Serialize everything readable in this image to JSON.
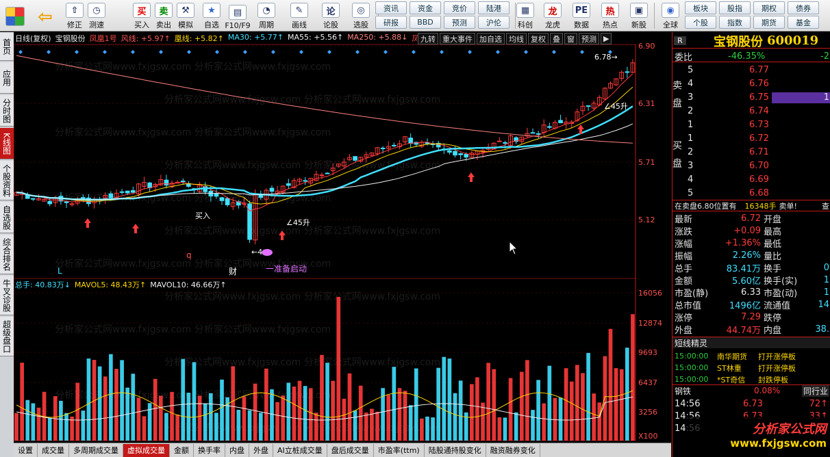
{
  "toolbar": {
    "nav": [
      {
        "label": "修正",
        "icon": "up-arrow-icon"
      },
      {
        "label": "测速",
        "icon": "clock-icon"
      },
      {
        "label": "买入",
        "icon": "buy-icon"
      },
      {
        "label": "卖出",
        "icon": "sell-icon"
      },
      {
        "label": "模拟",
        "icon": "hammer-icon"
      },
      {
        "label": "自选",
        "icon": "star-icon"
      },
      {
        "label": "F10/F9",
        "icon": "f10-icon"
      },
      {
        "label": "周期",
        "icon": "period-icon"
      },
      {
        "label": "画线",
        "icon": "pen-icon"
      },
      {
        "label": "论股",
        "icon": "talk-icon"
      },
      {
        "label": "选股",
        "icon": "select-stock-icon"
      },
      {
        "label": "科创",
        "icon": "kechuang-icon"
      },
      {
        "label": "龙虎",
        "icon": "dragon-tiger-icon"
      },
      {
        "label": "数据",
        "icon": "pe-icon"
      },
      {
        "label": "热点",
        "icon": "hot-icon"
      },
      {
        "label": "新股",
        "icon": "new-stock-icon"
      },
      {
        "label": "全球",
        "icon": "globe-icon"
      }
    ],
    "grid1": [
      "资讯",
      "资金",
      "竞价",
      "陆港",
      "研报",
      "BBD",
      "预测",
      "沪伦"
    ],
    "grid2": [
      "板块",
      "股指",
      "期权",
      "债券",
      "个股",
      "指数",
      "期货",
      "基金"
    ]
  },
  "sidetabs": [
    "首页",
    "应用",
    "分时图",
    "K线图",
    "个股资料",
    "自选股",
    "综合排名",
    "牛叉诊股",
    "超级盘口"
  ],
  "chart": {
    "legend": {
      "period": "日线(复权)",
      "name": "宝钢股份",
      "fh": "凤凰1号",
      "fengxian": "风线: +5.97↑",
      "huangxian": "凰线: +5.82↑",
      "ma30": "MA30: +5.77↑",
      "ma55": "MA55: +5.56↑",
      "ma250": "MA250: +5.88↓",
      "fengmo": "凤末"
    },
    "topbtns": [
      "九转",
      "重大事件",
      "加自选",
      "均线",
      "复权",
      "叠",
      "窗",
      "预测",
      "▶"
    ],
    "yaxis": [
      "6.90",
      "6.31",
      "5.71",
      "5.12"
    ],
    "volaxis": [
      "16056",
      "12874",
      "9693",
      "6437",
      "3256",
      "X100"
    ],
    "annotations": {
      "high": "6.78",
      "up45a": "45升",
      "up45b": "45升",
      "buy": "买入",
      "low": "4.6",
      "L": "L",
      "q": "q",
      "cai": "财",
      "start": "一准备启动"
    },
    "vol_legend": {
      "total": "总手: 40.83万↓",
      "mavol5": "MAVOL5: 48.43万↑",
      "mavol10": "MAVOL10: 46.66万↑"
    },
    "watermark": "分析家公式网www.fxjgsw.com"
  },
  "bottomtabs": [
    "设置",
    "成交量",
    "多周期成交量",
    "虚拟成交量",
    "金额",
    "换手率",
    "内盘",
    "外盘",
    "AI立桩成交量",
    "盘后成交量",
    "市盈率(ttm)",
    "陆股通持股变化",
    "融资融券变化"
  ],
  "quote": {
    "flag": "R",
    "name": "宝钢股份",
    "code": "600019",
    "weibi_label": "委比",
    "weibi": "-46.35%",
    "weibi_extra": "-2",
    "sell_label": "卖盘",
    "buy_label": "买盘",
    "asks": [
      {
        "lvl": "5",
        "price": "6.77"
      },
      {
        "lvl": "4",
        "price": "6.76"
      },
      {
        "lvl": "3",
        "price": "6.75",
        "vol": "1"
      },
      {
        "lvl": "2",
        "price": "6.74"
      },
      {
        "lvl": "1",
        "price": "6.73"
      }
    ],
    "bids": [
      {
        "lvl": "1",
        "price": "6.72"
      },
      {
        "lvl": "2",
        "price": "6.71"
      },
      {
        "lvl": "3",
        "price": "6.70"
      },
      {
        "lvl": "4",
        "price": "6.69"
      },
      {
        "lvl": "5",
        "price": "6.68"
      }
    ],
    "notice": "在卖盘6.80位置有",
    "notice_vol": "16348手",
    "notice_tail": "卖单!",
    "notice_btn": "查",
    "stats": [
      {
        "l": "最新",
        "v": "6.72",
        "c": "red",
        "l2": "开盘",
        "v2": ""
      },
      {
        "l": "涨跌",
        "v": "+0.09",
        "c": "red",
        "l2": "最高",
        "v2": ""
      },
      {
        "l": "涨幅",
        "v": "+1.36%",
        "c": "red",
        "l2": "最低",
        "v2": ""
      },
      {
        "l": "振幅",
        "v": "2.26%",
        "c": "cyan",
        "l2": "量比",
        "v2": ""
      },
      {
        "l": "总手",
        "v": "83.41万",
        "c": "cyan",
        "l2": "换手",
        "v2": "0"
      },
      {
        "l": "金额",
        "v": "5.60亿",
        "c": "cyan",
        "l2": "换手(实)",
        "v2": "1"
      },
      {
        "l": "市盈(静)",
        "v": "6.33",
        "c": "white",
        "l2": "市盈(动)",
        "v2": "1"
      },
      {
        "l": "总市值",
        "v": "1496亿",
        "c": "cyan",
        "l2": "流通值",
        "v2": "14"
      },
      {
        "l": "涨停",
        "v": "7.29",
        "c": "red",
        "l2": "跌停",
        "v2": ""
      },
      {
        "l": "外盘",
        "v": "44.74万",
        "c": "red",
        "l2": "内盘",
        "v2": "38."
      }
    ],
    "elf_title": "短线精灵",
    "elf": [
      {
        "t": "15:00:00",
        "n": "南华期货",
        "e": "打开涨停板"
      },
      {
        "t": "15:00:00",
        "n": "ST林重",
        "e": "打开涨停板"
      },
      {
        "t": "15:00:00",
        "n": "*ST奇信",
        "e": "封跌停板"
      }
    ],
    "sector": "钢铁",
    "sector_pct": "0.08%",
    "sector_btn": "同行业",
    "ticks": [
      {
        "t": "14:56",
        "p": "6.73",
        "v": "72↑"
      },
      {
        "t": "14:56",
        "p": "6.73",
        "v": "33↑"
      },
      {
        "t": "14:56",
        "p": "",
        "v": ""
      }
    ]
  },
  "watermark_logo": "分析家公式网",
  "watermark_url": "www.fxjgsw.com",
  "colors": {
    "up": "#ff3b3b",
    "down": "#40e0ff",
    "accent": "#c41818"
  }
}
